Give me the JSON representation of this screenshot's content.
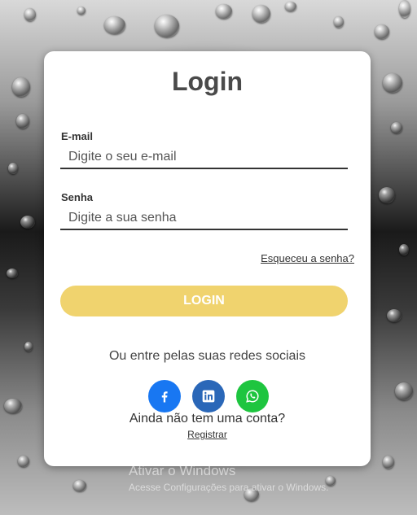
{
  "login": {
    "title": "Login",
    "email_label": "E-mail",
    "email_placeholder": "Digite o seu e-mail",
    "password_label": "Senha",
    "password_placeholder": "Digite a sua senha",
    "forgot_link": "Esqueceu a senha?",
    "login_button": "LOGIN",
    "social_text": "Ou entre pelas suas redes sociais",
    "social_icons": [
      "facebook-icon",
      "linkedin-icon",
      "whatsapp-icon"
    ],
    "no_account_text": "Ainda não tem uma conta?",
    "register_link": "Registrar"
  },
  "watermark": {
    "title": "Ativar o Windows",
    "subtitle": "Acesse Configurações para ativar o Windows."
  },
  "colors": {
    "button": "#f0d36e",
    "facebook": "#1877f2",
    "linkedin": "#2a67b8",
    "whatsapp": "#1ec53f"
  }
}
